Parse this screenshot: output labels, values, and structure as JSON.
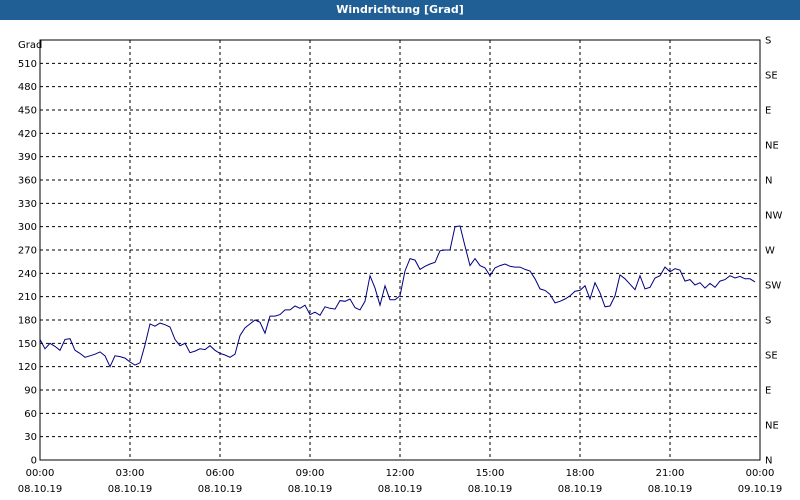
{
  "window": {
    "title": "Windrichtung [Grad]"
  },
  "colors": {
    "titlebar": "#1f5f96",
    "series": "#000080",
    "grid": "#000000"
  },
  "chart_data": {
    "type": "line",
    "title": "Windrichtung [Grad]",
    "ylabel": "Grad",
    "ylim": [
      0,
      540
    ],
    "y_ticks": [
      0,
      30,
      60,
      90,
      120,
      150,
      180,
      210,
      240,
      270,
      300,
      330,
      360,
      390,
      420,
      450,
      480,
      510
    ],
    "y2_ticks": [
      "N",
      "NE",
      "E",
      "SE",
      "S",
      "SW",
      "W",
      "NW",
      "N",
      "NE",
      "E",
      "SE",
      "S"
    ],
    "xlim": [
      "2019-10-08 00:00",
      "2019-10-09 00:00"
    ],
    "x_ticks": [
      {
        "time": "00:00",
        "date": "08.10.19"
      },
      {
        "time": "03:00",
        "date": "08.10.19"
      },
      {
        "time": "06:00",
        "date": "08.10.19"
      },
      {
        "time": "09:00",
        "date": "08.10.19"
      },
      {
        "time": "12:00",
        "date": "08.10.19"
      },
      {
        "time": "15:00",
        "date": "08.10.19"
      },
      {
        "time": "18:00",
        "date": "08.10.19"
      },
      {
        "time": "21:00",
        "date": "08.10.19"
      },
      {
        "time": "00:00",
        "date": "09.10.19"
      }
    ],
    "grid": true,
    "series": [
      {
        "x": [
          "2019-10-08 00:00",
          "2019-10-08 00:10",
          "2019-10-08 00:20",
          "2019-10-08 00:30",
          "2019-10-08 00:40",
          "2019-10-08 00:50",
          "2019-10-08 01:00",
          "2019-10-08 01:10",
          "2019-10-08 01:20",
          "2019-10-08 01:30",
          "2019-10-08 01:40",
          "2019-10-08 01:50",
          "2019-10-08 02:00",
          "2019-10-08 02:10",
          "2019-10-08 02:20",
          "2019-10-08 02:30",
          "2019-10-08 02:40",
          "2019-10-08 02:50",
          "2019-10-08 03:00",
          "2019-10-08 03:10",
          "2019-10-08 03:20",
          "2019-10-08 03:30",
          "2019-10-08 03:40",
          "2019-10-08 03:50",
          "2019-10-08 04:00",
          "2019-10-08 04:10",
          "2019-10-08 04:20",
          "2019-10-08 04:30",
          "2019-10-08 04:40",
          "2019-10-08 04:50",
          "2019-10-08 05:00",
          "2019-10-08 05:10",
          "2019-10-08 05:20",
          "2019-10-08 05:30",
          "2019-10-08 05:40",
          "2019-10-08 05:50",
          "2019-10-08 06:00",
          "2019-10-08 06:10",
          "2019-10-08 06:20",
          "2019-10-08 06:30",
          "2019-10-08 06:40",
          "2019-10-08 06:50",
          "2019-10-08 07:00",
          "2019-10-08 07:10",
          "2019-10-08 07:20",
          "2019-10-08 07:30",
          "2019-10-08 07:40",
          "2019-10-08 07:50",
          "2019-10-08 08:00",
          "2019-10-08 08:10",
          "2019-10-08 08:20",
          "2019-10-08 08:30",
          "2019-10-08 08:40",
          "2019-10-08 08:50",
          "2019-10-08 09:00",
          "2019-10-08 09:10",
          "2019-10-08 09:20",
          "2019-10-08 09:30",
          "2019-10-08 09:40",
          "2019-10-08 09:50",
          "2019-10-08 10:00",
          "2019-10-08 10:10",
          "2019-10-08 10:20",
          "2019-10-08 10:30",
          "2019-10-08 10:40",
          "2019-10-08 10:50",
          "2019-10-08 11:00",
          "2019-10-08 11:10",
          "2019-10-08 11:20",
          "2019-10-08 11:30",
          "2019-10-08 11:40",
          "2019-10-08 11:50",
          "2019-10-08 12:00",
          "2019-10-08 12:10",
          "2019-10-08 12:20",
          "2019-10-08 12:30",
          "2019-10-08 12:40",
          "2019-10-08 12:50",
          "2019-10-08 13:00",
          "2019-10-08 13:10",
          "2019-10-08 13:20",
          "2019-10-08 13:30",
          "2019-10-08 13:40",
          "2019-10-08 13:50",
          "2019-10-08 14:00",
          "2019-10-08 14:10",
          "2019-10-08 14:20",
          "2019-10-08 14:30",
          "2019-10-08 14:40",
          "2019-10-08 14:50",
          "2019-10-08 15:00",
          "2019-10-08 15:10",
          "2019-10-08 15:20",
          "2019-10-08 15:30",
          "2019-10-08 15:40",
          "2019-10-08 15:50",
          "2019-10-08 16:00",
          "2019-10-08 16:10",
          "2019-10-08 16:20",
          "2019-10-08 16:30",
          "2019-10-08 16:40",
          "2019-10-08 16:50",
          "2019-10-08 17:00",
          "2019-10-08 17:10",
          "2019-10-08 17:20",
          "2019-10-08 17:30",
          "2019-10-08 17:40",
          "2019-10-08 17:50",
          "2019-10-08 18:00",
          "2019-10-08 18:10",
          "2019-10-08 18:20",
          "2019-10-08 18:30",
          "2019-10-08 18:40",
          "2019-10-08 18:50",
          "2019-10-08 19:00",
          "2019-10-08 19:10",
          "2019-10-08 19:20",
          "2019-10-08 19:30",
          "2019-10-08 19:40",
          "2019-10-08 19:50",
          "2019-10-08 20:00",
          "2019-10-08 20:10",
          "2019-10-08 20:20",
          "2019-10-08 20:30",
          "2019-10-08 20:40",
          "2019-10-08 20:50",
          "2019-10-08 21:00",
          "2019-10-08 21:10",
          "2019-10-08 21:20",
          "2019-10-08 21:30",
          "2019-10-08 21:40",
          "2019-10-08 21:50",
          "2019-10-08 22:00",
          "2019-10-08 22:10",
          "2019-10-08 22:20",
          "2019-10-08 22:30",
          "2019-10-08 22:40",
          "2019-10-08 22:50",
          "2019-10-08 23:00",
          "2019-10-08 23:10",
          "2019-10-08 23:20",
          "2019-10-08 23:30",
          "2019-10-08 23:40",
          "2019-10-08 23:50"
        ],
        "y": [
          155,
          143,
          150,
          146,
          141,
          155,
          156,
          141,
          137,
          132,
          134,
          136,
          139,
          134,
          120,
          134,
          133,
          131,
          126,
          122,
          125,
          148,
          175,
          172,
          176,
          174,
          171,
          155,
          147,
          150,
          138,
          140,
          143,
          142,
          147,
          141,
          137,
          135,
          132,
          136,
          160,
          170,
          175,
          180,
          177,
          163,
          185,
          185,
          187,
          193,
          193,
          198,
          195,
          199,
          187,
          190,
          186,
          197,
          195,
          194,
          205,
          204,
          207,
          196,
          193,
          204,
          237,
          221,
          199,
          224,
          206,
          206,
          211,
          243,
          259,
          257,
          245,
          249,
          252,
          254,
          269,
          270,
          270,
          300,
          301,
          275,
          250,
          259,
          250,
          247,
          237,
          247,
          250,
          252,
          249,
          248,
          248,
          245,
          243,
          233,
          220,
          218,
          213,
          202,
          204,
          207,
          211,
          217,
          218,
          224,
          207,
          228,
          215,
          197,
          198,
          211,
          238,
          233,
          226,
          219,
          237,
          220,
          222,
          234,
          237,
          248,
          242,
          246,
          244,
          230,
          232,
          225,
          228,
          221,
          227,
          222,
          230,
          232,
          237,
          234,
          236,
          233,
          233,
          229
        ]
      }
    ]
  }
}
